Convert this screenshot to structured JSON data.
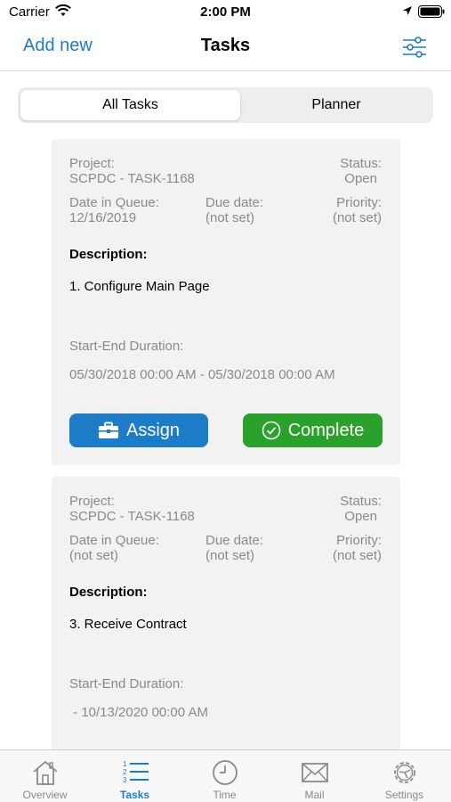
{
  "status_bar": {
    "carrier": "Carrier",
    "time": "2:00 PM"
  },
  "nav": {
    "add_label": "Add new",
    "title": "Tasks"
  },
  "segments": {
    "all": "All Tasks",
    "planner": "Planner"
  },
  "labels": {
    "project": "Project:",
    "status": "Status:",
    "date_in_queue": "Date in Queue:",
    "due_date": "Due date:",
    "priority": "Priority:",
    "description": "Description:",
    "duration": "Start-End Duration:"
  },
  "tasks": [
    {
      "project": "SCPDC - TASK-1168",
      "status": "Open",
      "date_in_queue": "12/16/2019",
      "due_date": "(not set)",
      "priority": "(not set)",
      "description": "1. Configure Main Page",
      "duration": "05/30/2018 00:00 AM - 05/30/2018 00:00 AM",
      "assign_label": "Assign",
      "complete_label": "Complete"
    },
    {
      "project": "SCPDC - TASK-1168",
      "status": "Open",
      "date_in_queue": "(not set)",
      "due_date": "(not set)",
      "priority": "(not set)",
      "description": "3. Receive Contract",
      "duration": " - 10/13/2020 00:00 AM"
    }
  ],
  "tabs": [
    {
      "label": "Overview",
      "icon": "house-icon"
    },
    {
      "label": "Tasks",
      "icon": "list-icon"
    },
    {
      "label": "Time",
      "icon": "clock-icon"
    },
    {
      "label": "Mail",
      "icon": "envelope-icon"
    },
    {
      "label": "Settings",
      "icon": "gear-icon"
    }
  ],
  "colors": {
    "accent": "#1d7cc7",
    "complete": "#2aa12a",
    "muted": "#8a8a8e"
  }
}
